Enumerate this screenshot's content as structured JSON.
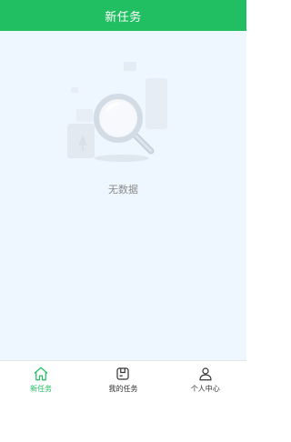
{
  "header": {
    "title": "新任务"
  },
  "empty_state": {
    "icon": "search-magnifier-icon",
    "text": "无数据"
  },
  "tabbar": {
    "active_index": 0,
    "items": [
      {
        "label": "新任务",
        "icon": "home-icon"
      },
      {
        "label": "我的任务",
        "icon": "task-box-icon"
      },
      {
        "label": "个人中心",
        "icon": "person-icon"
      }
    ]
  },
  "colors": {
    "primary": "#21bf61",
    "content_background": "#eef6ff",
    "muted_text": "#8c8c8c"
  }
}
